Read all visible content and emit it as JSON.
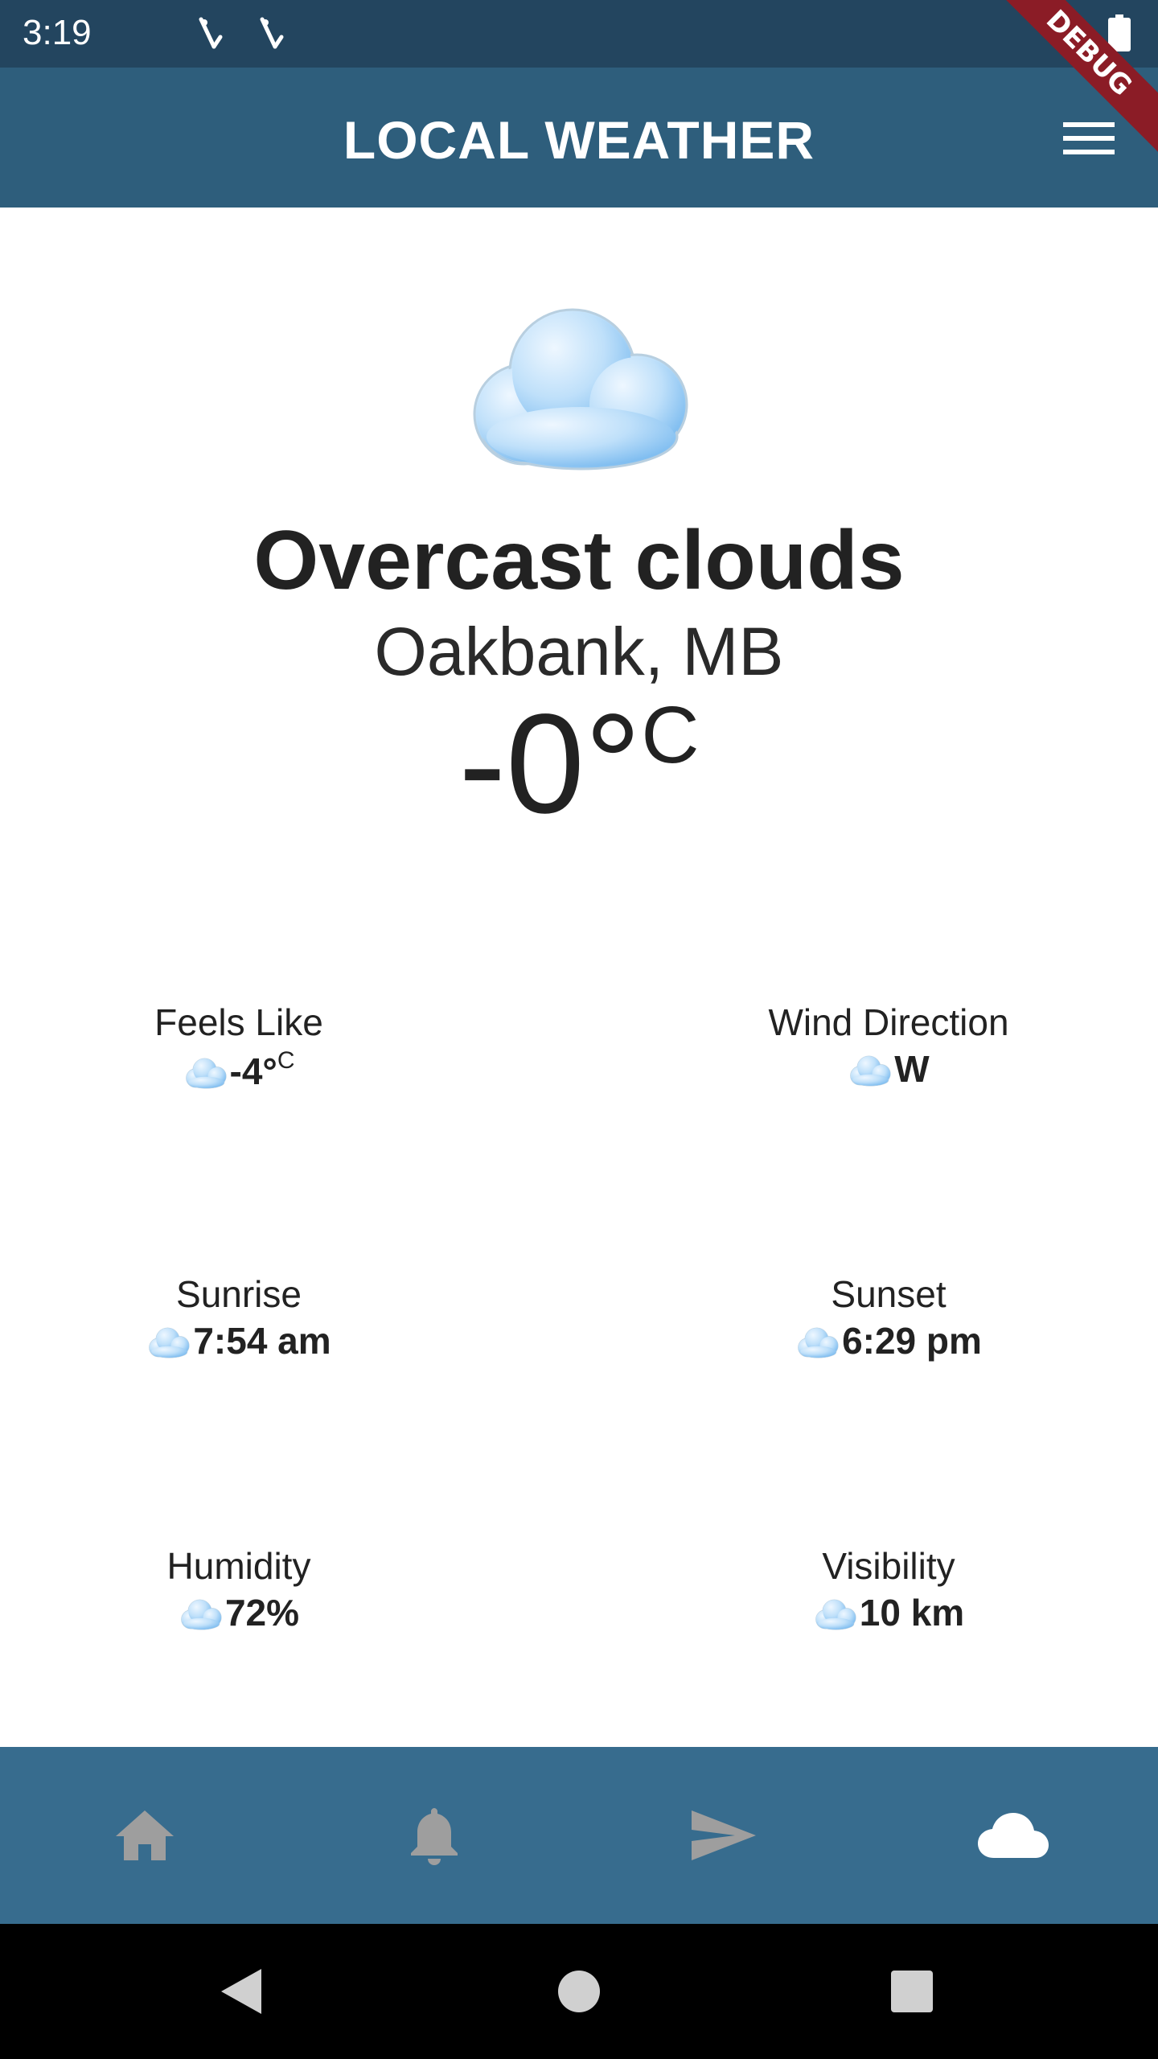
{
  "status_bar": {
    "time": "3:19",
    "icons": [
      "signal-icon",
      "signal-icon",
      "battery-icon"
    ]
  },
  "debug_banner": "DEBUG",
  "app_bar": {
    "title": "LOCAL WEATHER",
    "menu_icon": "menu-icon"
  },
  "weather": {
    "icon": "cloud-icon",
    "condition": "Overcast clouds",
    "location": "Oakbank, MB",
    "temperature": "-0°",
    "unit": "C"
  },
  "details": [
    {
      "label": "Feels Like",
      "value": "-4°",
      "sup": "C",
      "icon": "cloud-icon"
    },
    {
      "label": "Wind Direction",
      "value": "W",
      "sup": "",
      "icon": "cloud-icon"
    },
    {
      "label": "Sunrise",
      "value": "7:54 am",
      "sup": "",
      "icon": "cloud-icon"
    },
    {
      "label": "Sunset",
      "value": "6:29 pm",
      "sup": "",
      "icon": "cloud-icon"
    },
    {
      "label": "Humidity",
      "value": "72%",
      "sup": "",
      "icon": "cloud-icon"
    },
    {
      "label": "Visibility",
      "value": "10 km",
      "sup": "",
      "icon": "cloud-icon"
    }
  ],
  "bottom_nav": {
    "items": [
      "home-icon",
      "bell-icon",
      "send-icon",
      "cloud-icon"
    ],
    "active": "cloud-icon"
  },
  "system_nav": [
    "back-icon",
    "home-circle-icon",
    "recents-icon"
  ],
  "colors": {
    "status_bar": "#23455f",
    "app_bar": "#2e5e7c",
    "bottom_nav": "#376c8e",
    "nav_inactive": "#9e9e9e",
    "nav_active": "#ffffff",
    "debug": "#8b1c26"
  }
}
